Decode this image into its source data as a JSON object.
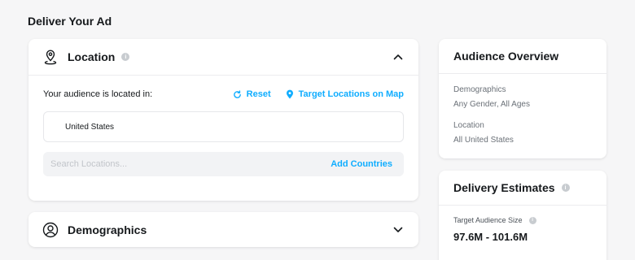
{
  "page": {
    "title": "Deliver Your Ad"
  },
  "location": {
    "title": "Location",
    "audience_label": "Your audience is located in:",
    "reset_label": "Reset",
    "map_label": "Target Locations on Map",
    "selected_location": "United States",
    "search_placeholder": "Search Locations...",
    "add_countries_label": "Add Countries",
    "expanded": true
  },
  "demographics": {
    "title": "Demographics",
    "expanded": false
  },
  "audience_overview": {
    "title": "Audience Overview",
    "demographics_label": "Demographics",
    "demographics_value": "Any Gender, All Ages",
    "location_label": "Location",
    "location_value": "All United States"
  },
  "delivery_estimates": {
    "title": "Delivery Estimates",
    "target_size_label": "Target Audience Size",
    "target_size_value": "97.6M - 101.6M"
  },
  "colors": {
    "accent": "#0fadff",
    "background": "#f6f6f7",
    "card": "#ffffff"
  },
  "icons": {
    "location": "map-pin-icon",
    "demographics": "user-circle-icon",
    "info": "info-icon",
    "collapse": "chevron-up-icon",
    "expand": "chevron-down-icon",
    "reset": "refresh-icon",
    "map": "map-marker-icon"
  }
}
